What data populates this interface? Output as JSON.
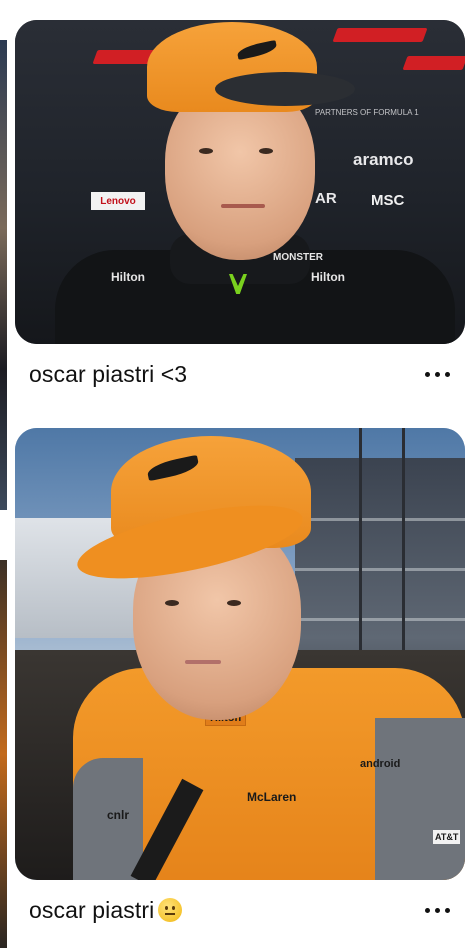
{
  "feed": {
    "pins": [
      {
        "title": "oscar piastri <3",
        "more_label": "More options",
        "image": {
          "backdrop_text": [
            "aramco",
            "Lenovo",
            "MSC",
            "AR",
            "PARTNERS OF FORMULA 1"
          ],
          "suit_text": [
            "Hilton",
            "Hilton",
            "MONSTER"
          ]
        }
      },
      {
        "title": "oscar piastri",
        "emoji": "neutral-face-emoji",
        "more_label": "More options",
        "image": {
          "suit_text": [
            "Hilton",
            "android",
            "McLaren",
            "AT&T",
            "Hilton",
            "cnlr"
          ]
        }
      }
    ]
  },
  "colors": {
    "background": "#ffffff",
    "text": "#111111",
    "papaya": "#f0901f",
    "f1_red": "#d11f24"
  }
}
